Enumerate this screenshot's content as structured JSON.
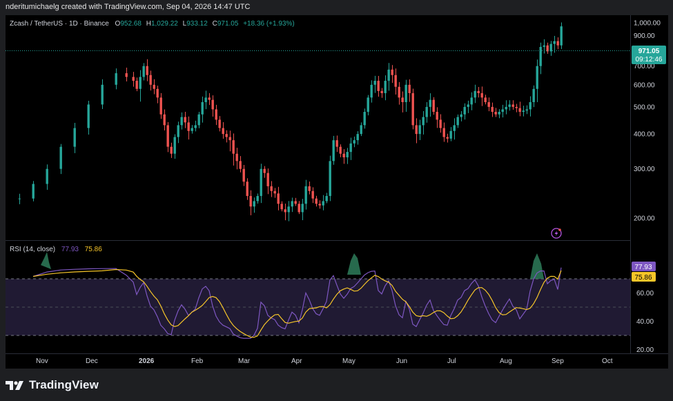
{
  "attribution": "nderitumichaelg created with TradingView.com, Sep 04, 2026 14:47 UTC",
  "legend": {
    "symbol": "Zcash / TetherUS · 1D · Binance",
    "o_label": "O",
    "o": "952.68",
    "h_label": "H",
    "h": "1,029.22",
    "l_label": "L",
    "l": "933.12",
    "c_label": "C",
    "c": "971.05",
    "change": "+18.36 (+1.93%)"
  },
  "price_badge": {
    "price": "971.05",
    "countdown": "09:12:46"
  },
  "rsi_legend": {
    "label": "RSI (14, close)",
    "rsi": "77.93",
    "ma": "75.86"
  },
  "footer": {
    "brand": "TradingView"
  },
  "colors": {
    "up": "#26a69a",
    "down": "#ef5350",
    "rsi": "#7e57c2",
    "rsi_ma": "#f7c629",
    "band": "#201a33",
    "background": "#000000",
    "text": "#d1d4dc"
  },
  "icons": {
    "alert": "lightning-bolt-icon",
    "logo": "tradingview-logo-icon"
  },
  "chart_data": [
    {
      "type": "candlestick",
      "title": "Zcash / TetherUS · 1D · Binance",
      "y_ticks": [
        200,
        300,
        400,
        500,
        600,
        700,
        800,
        900,
        "1,000.00"
      ],
      "y_scale": "log",
      "x_ticks": [
        "Nov",
        "Dec",
        "2026",
        "Feb",
        "Mar",
        "Apr",
        "May",
        "Jun",
        "Jul",
        "Aug",
        "Sep",
        "Oct"
      ],
      "last_close": 971.05,
      "ohlc_approx": [
        [
          20,
          235
        ],
        [
          40,
          265
        ],
        [
          60,
          300
        ],
        [
          80,
          360
        ],
        [
          100,
          420
        ],
        [
          120,
          510
        ],
        [
          140,
          600
        ],
        [
          160,
          660
        ],
        [
          175,
          640
        ],
        [
          185,
          620
        ],
        [
          190,
          580
        ],
        [
          195,
          640
        ],
        [
          200,
          700
        ],
        [
          205,
          650
        ],
        [
          210,
          600
        ],
        [
          215,
          580
        ],
        [
          220,
          540
        ],
        [
          225,
          470
        ],
        [
          230,
          430
        ],
        [
          235,
          360
        ],
        [
          240,
          340
        ],
        [
          245,
          390
        ],
        [
          250,
          430
        ],
        [
          255,
          460
        ],
        [
          260,
          440
        ],
        [
          265,
          410
        ],
        [
          270,
          420
        ],
        [
          275,
          430
        ],
        [
          280,
          470
        ],
        [
          285,
          520
        ],
        [
          290,
          540
        ],
        [
          295,
          530
        ],
        [
          300,
          490
        ],
        [
          305,
          450
        ],
        [
          310,
          420
        ],
        [
          315,
          400
        ],
        [
          320,
          390
        ],
        [
          325,
          380
        ],
        [
          330,
          340
        ],
        [
          335,
          320
        ],
        [
          340,
          300
        ],
        [
          345,
          270
        ],
        [
          350,
          240
        ],
        [
          355,
          220
        ],
        [
          360,
          230
        ],
        [
          365,
          240
        ],
        [
          370,
          300
        ],
        [
          375,
          290
        ],
        [
          380,
          260
        ],
        [
          385,
          250
        ],
        [
          390,
          245
        ],
        [
          395,
          225
        ],
        [
          400,
          215
        ],
        [
          405,
          210
        ],
        [
          410,
          220
        ],
        [
          415,
          230
        ],
        [
          420,
          225
        ],
        [
          425,
          210
        ],
        [
          430,
          225
        ],
        [
          435,
          260
        ],
        [
          440,
          250
        ],
        [
          445,
          235
        ],
        [
          450,
          225
        ],
        [
          455,
          222
        ],
        [
          460,
          230
        ],
        [
          465,
          240
        ],
        [
          470,
          320
        ],
        [
          475,
          380
        ],
        [
          480,
          360
        ],
        [
          485,
          340
        ],
        [
          490,
          330
        ],
        [
          495,
          345
        ],
        [
          500,
          370
        ],
        [
          505,
          380
        ],
        [
          510,
          400
        ],
        [
          515,
          430
        ],
        [
          520,
          480
        ],
        [
          525,
          540
        ],
        [
          530,
          600
        ],
        [
          535,
          620
        ],
        [
          540,
          570
        ],
        [
          545,
          560
        ],
        [
          550,
          620
        ],
        [
          555,
          680
        ],
        [
          560,
          650
        ],
        [
          565,
          590
        ],
        [
          570,
          540
        ],
        [
          575,
          520
        ],
        [
          580,
          600
        ],
        [
          585,
          560
        ],
        [
          590,
          430
        ],
        [
          595,
          400
        ],
        [
          600,
          430
        ],
        [
          605,
          460
        ],
        [
          610,
          500
        ],
        [
          615,
          530
        ],
        [
          620,
          480
        ],
        [
          625,
          450
        ],
        [
          630,
          420
        ],
        [
          635,
          390
        ],
        [
          640,
          385
        ],
        [
          645,
          410
        ],
        [
          650,
          430
        ],
        [
          655,
          460
        ],
        [
          660,
          470
        ],
        [
          665,
          500
        ],
        [
          670,
          510
        ],
        [
          675,
          540
        ],
        [
          680,
          570
        ],
        [
          685,
          560
        ],
        [
          690,
          540
        ],
        [
          695,
          520
        ],
        [
          700,
          500
        ],
        [
          705,
          480
        ],
        [
          710,
          470
        ],
        [
          715,
          480
        ],
        [
          720,
          490
        ],
        [
          725,
          500
        ],
        [
          730,
          510
        ],
        [
          735,
          500
        ],
        [
          740,
          495
        ],
        [
          745,
          480
        ],
        [
          750,
          485
        ],
        [
          755,
          490
        ],
        [
          760,
          520
        ],
        [
          765,
          580
        ],
        [
          770,
          700
        ],
        [
          775,
          820
        ],
        [
          780,
          830
        ],
        [
          785,
          790
        ],
        [
          790,
          840
        ],
        [
          795,
          860
        ],
        [
          800,
          830
        ],
        [
          805,
          971.05
        ]
      ]
    },
    {
      "type": "line",
      "title": "RSI (14, close)",
      "y_ticks": [
        20.0,
        40.0,
        60.0
      ],
      "bands": {
        "upper": 70,
        "middle": 50,
        "lower": 30
      },
      "series": [
        {
          "name": "RSI",
          "last": 77.93
        },
        {
          "name": "MA",
          "last": 75.86
        }
      ]
    }
  ]
}
